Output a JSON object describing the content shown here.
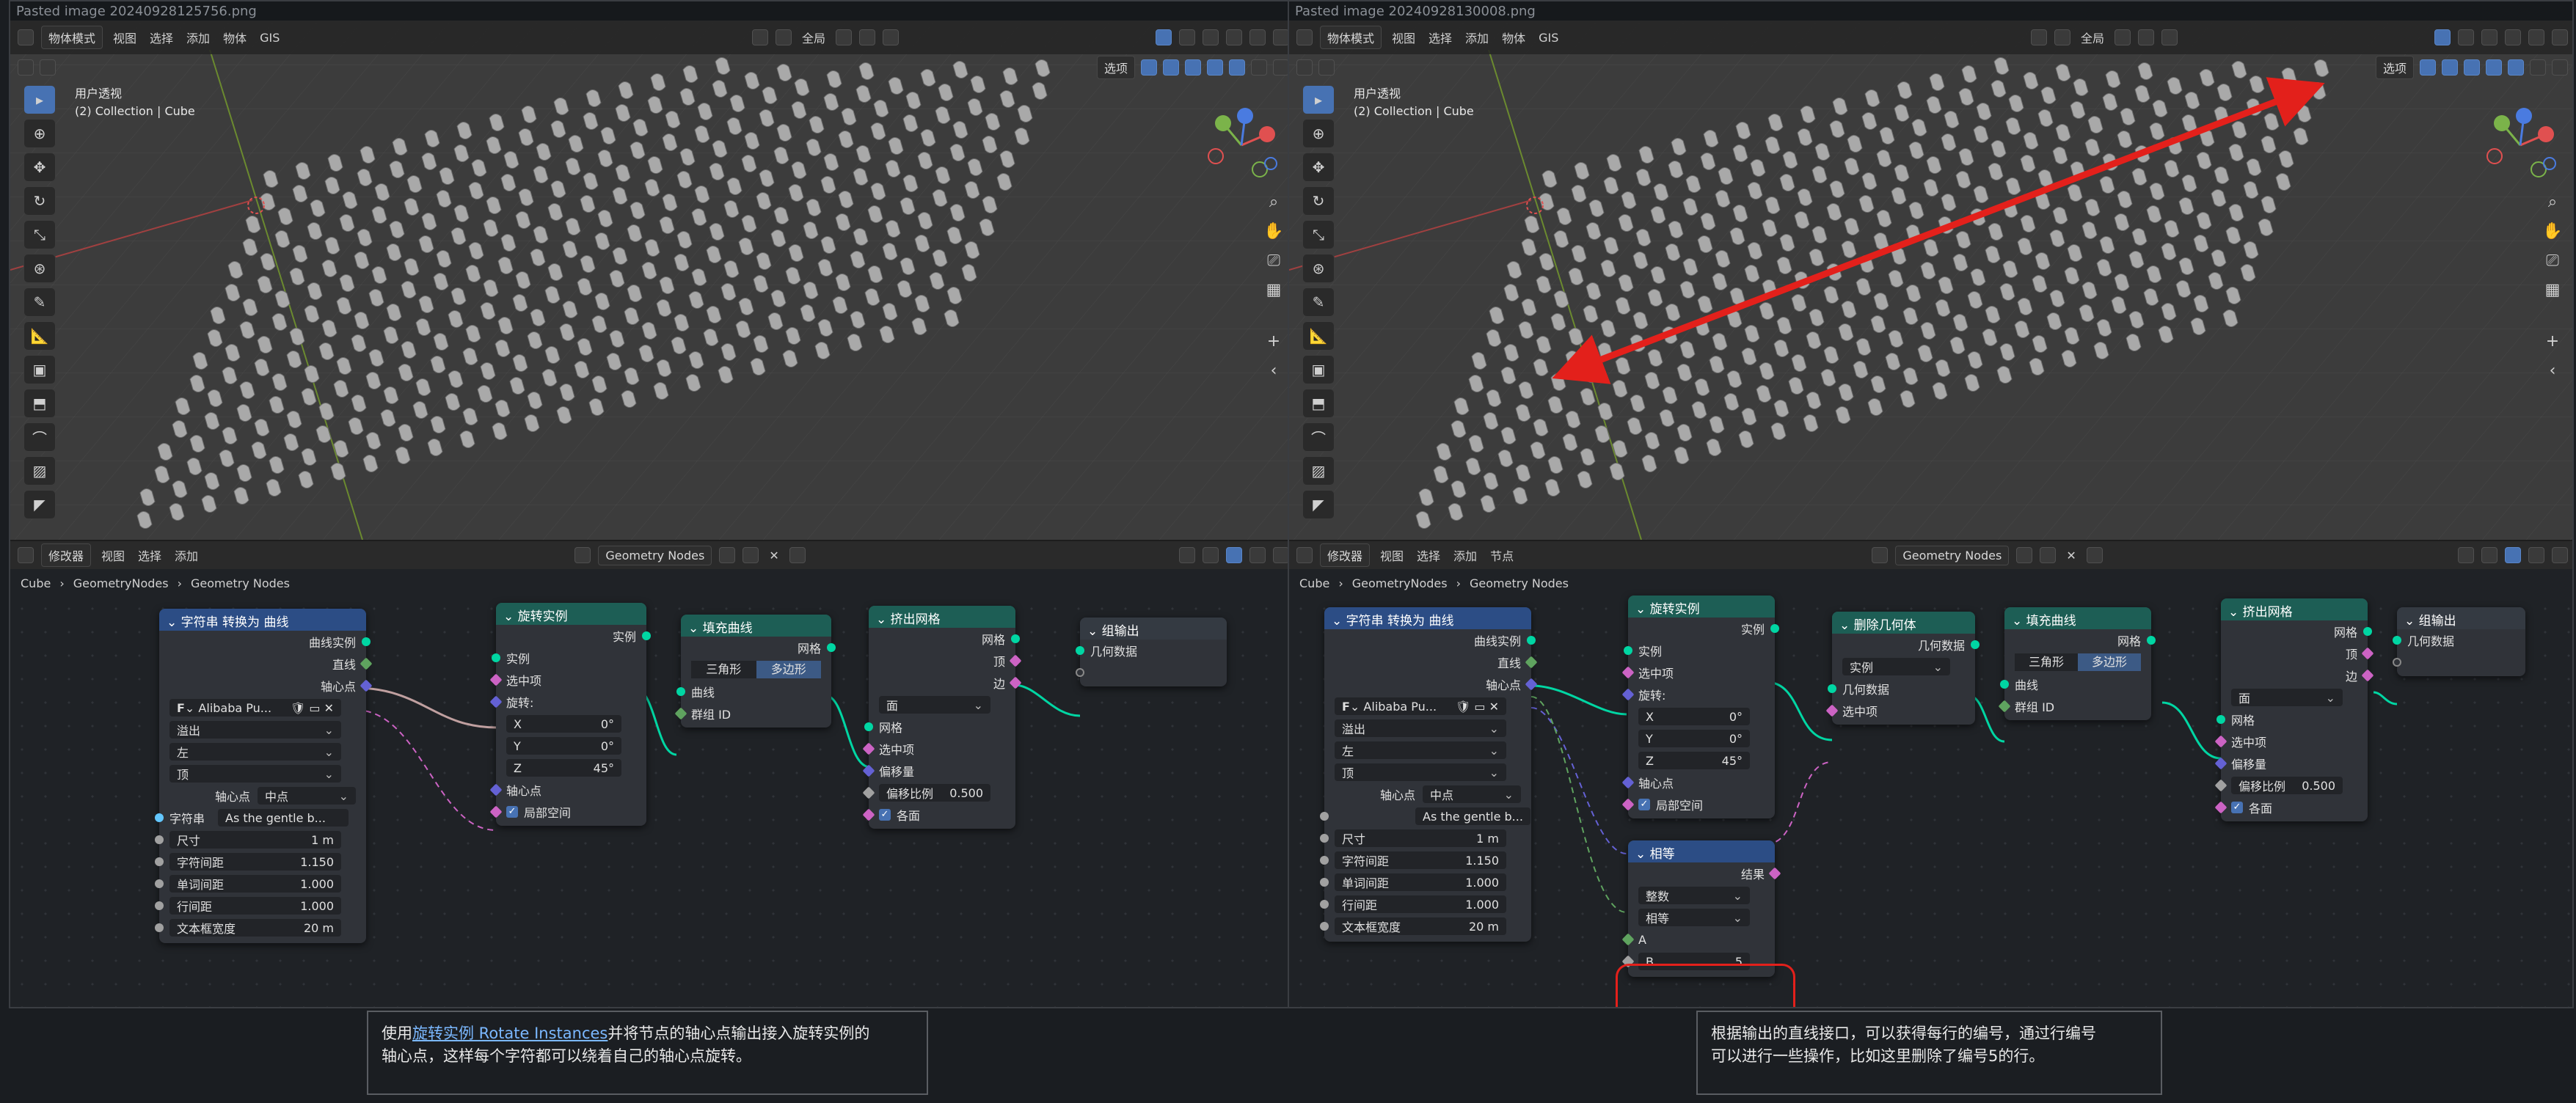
{
  "left": {
    "title": "Pasted image 20240928125756.png",
    "mode": "物体模式",
    "menus": [
      "视图",
      "选择",
      "添加",
      "物体",
      "GIS"
    ],
    "global": "全局",
    "view_name": "用户透视",
    "collection": "(2) Collection | Cube",
    "select_btn": "选项",
    "editor": {
      "mode": "修改器",
      "menus": [
        "视图",
        "选择",
        "添加"
      ],
      "tree": "Geometry Nodes",
      "breadcrumb": [
        "Cube",
        "GeometryNodes",
        "Geometry Nodes"
      ]
    }
  },
  "right": {
    "title": "Pasted image 20240928130008.png",
    "mode": "物体模式",
    "menus": [
      "视图",
      "选择",
      "添加",
      "物体",
      "GIS"
    ],
    "global": "全局",
    "view_name": "用户透视",
    "collection": "(2) Collection | Cube",
    "select_btn": "选项",
    "editor": {
      "mode": "修改器",
      "menus": [
        "视图",
        "选择",
        "添加",
        "节点"
      ],
      "tree": "Geometry Nodes",
      "breadcrumb": [
        "Cube",
        "GeometryNodes",
        "Geometry Nodes"
      ]
    }
  },
  "nodes": {
    "str2curve": {
      "title": "字符串 转换为 曲线",
      "out_instances": "曲线实例",
      "out_line": "直线",
      "out_pivot": "轴心点",
      "font": "Alibaba Pu...",
      "overflow": "溢出",
      "align_x": "左",
      "align_y": "顶",
      "pivot_label": "轴心点",
      "pivot_val": "中点",
      "string_label": "字符串",
      "string_val": "As the gentle b...",
      "size_label": "尺寸",
      "size_val": "1 m",
      "char_spacing_label": "字符间距",
      "char_spacing_val": "1.150",
      "word_spacing_label": "单词间距",
      "word_spacing_val": "1.000",
      "line_spacing_label": "行间距",
      "line_spacing_val": "1.000",
      "textbox_label": "文本框宽度",
      "textbox_val": "20 m"
    },
    "rotate": {
      "title": "旋转实例",
      "out": "实例",
      "in_instances": "实例",
      "in_selection": "选中项",
      "in_rotation": "旋转:",
      "x_label": "X",
      "x_val": "0°",
      "y_label": "Y",
      "y_val": "0°",
      "z_label": "Z",
      "z_val": "45°",
      "pivot": "轴心点",
      "local": "局部空间"
    },
    "fill": {
      "title": "填充曲线",
      "out": "网格",
      "seg_a": "三角形",
      "seg_b": "多边形",
      "in_curve": "曲线",
      "in_group": "群组 ID"
    },
    "extrude": {
      "title": "挤出网格",
      "out_mesh": "网格",
      "out_top": "顶",
      "out_side": "边",
      "mode": "面",
      "in_mesh": "网格",
      "in_sel": "选中项",
      "in_offset": "偏移量",
      "scale_label": "偏移比例",
      "scale_val": "0.500",
      "individual": "各面"
    },
    "output": {
      "title": "组输出",
      "in_geo": "几何数据"
    },
    "delete": {
      "title": "删除几何体",
      "out": "几何数据",
      "domain": "实例",
      "in_geo": "几何数据",
      "in_sel": "选中项"
    },
    "compare": {
      "title": "相等",
      "out": "结果",
      "type": "整数",
      "op": "相等",
      "a": "A",
      "b_label": "B",
      "b_val": "5"
    }
  },
  "captions": {
    "left_link": "旋转实例  Rotate Instances",
    "left_pre": "使用",
    "left_post": "并将节点的轴心点输出接入旋转实例的",
    "left_line2": "轴心点，这样每个字符都可以绕着自己的轴心点旋转。",
    "right_line1": "根据输出的直线接口，可以获得每行的编号，通过行编号",
    "right_line2": "可以进行一些操作，比如这里删除了编号5的行。"
  },
  "colors": {
    "geometry_socket": "#00d6a3",
    "selection_socket": "#cc63c4",
    "vector_socket": "#6461d4",
    "annotation_red": "#e3201b",
    "active_blue": "#4772b3"
  }
}
